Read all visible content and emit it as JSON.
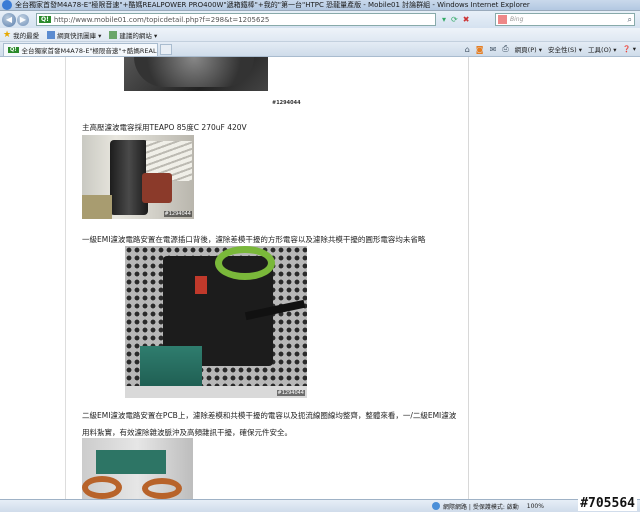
{
  "window": {
    "title": "全台獨家首發M4A78-E\"極限音速\"+酷媽REALPOWER PRO400W\"遞箱鐵棒\"+我的\"第一台\"HTPC 恐龍量產版 - Mobile01 討論群組 - Windows Internet Explorer"
  },
  "address_bar": {
    "badge": "Q!",
    "url": "http://www.mobile01.com/topicdetail.php?f=298&t=1205625",
    "search_placeholder": "Bing"
  },
  "favorites_bar": {
    "favorites_label": "我的最愛",
    "suggested_sites": "建議的網站 ▾",
    "web_slice": "網頁快訊圖庫 ▾"
  },
  "tabs": [
    {
      "badge": "Q!",
      "label": "全台獨家首發M4A78-E\"極限音速\"+酷媽REALP..."
    }
  ],
  "command_bar": {
    "page": "網頁(P) ▾",
    "safety": "安全性(S) ▾",
    "tools": "工具(O) ▾",
    "help": "❓ ▾"
  },
  "post": {
    "img_watermark": "#1294044",
    "caption1": "主高壓濾波電容採用TEAPO 85度C 270uF 420V",
    "caption2": "一級EMI濾波電路安置在電源插口背後，濾除差模干擾的方形電容以及濾除共模干擾的圓形電容均未省略",
    "caption3_line1": "二級EMI濾波電路安置在PCB上，濾除差模和共模干擾的電容以及扼流線圈線均整齊，整體來看，一/二級EMI濾波",
    "caption3_line2": "用料紮實，有效濾除雜波脈沖及高頻雜訊干擾，確保元件安全。"
  },
  "status_bar": {
    "zone": "網際網路 | 受保護模式: 啟動",
    "zoom": "100%"
  },
  "overlay_watermark": "#705564"
}
